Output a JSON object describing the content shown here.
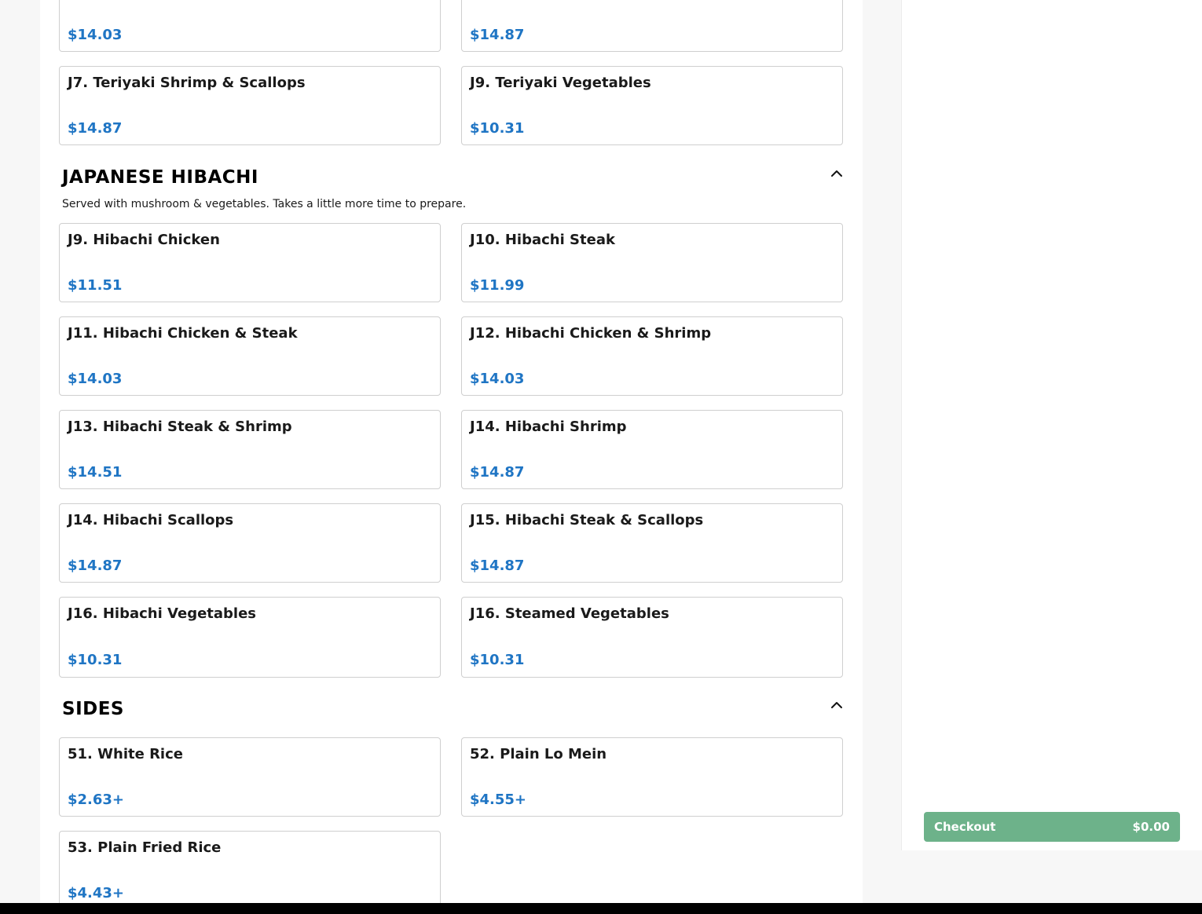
{
  "teriyaki": {
    "items": [
      {
        "name": "",
        "price": "$14.03"
      },
      {
        "name": "",
        "price": "$14.87"
      },
      {
        "name": "J7. Teriyaki Shrimp & Scallops",
        "price": "$14.87"
      },
      {
        "name": "J9. Teriyaki Vegetables",
        "price": "$10.31"
      }
    ]
  },
  "hibachi": {
    "title": "JAPANESE HIBACHI",
    "description": "Served with mushroom & vegetables. Takes a little more time to prepare.",
    "collapse_icon": "chevron-up-icon",
    "items": [
      {
        "name": "J9. Hibachi Chicken",
        "price": "$11.51"
      },
      {
        "name": "J10. Hibachi Steak",
        "price": "$11.99"
      },
      {
        "name": "J11. Hibachi Chicken & Steak",
        "price": "$14.03"
      },
      {
        "name": "J12. Hibachi Chicken & Shrimp",
        "price": "$14.03"
      },
      {
        "name": "J13. Hibachi Steak & Shrimp",
        "price": "$14.51"
      },
      {
        "name": "J14. Hibachi Shrimp",
        "price": "$14.87"
      },
      {
        "name": "J14. Hibachi Scallops",
        "price": "$14.87"
      },
      {
        "name": "J15. Hibachi Steak & Scallops",
        "price": "$14.87"
      },
      {
        "name": "J16. Hibachi Vegetables",
        "price": "$10.31"
      },
      {
        "name": "J16. Steamed Vegetables",
        "price": "$10.31"
      }
    ]
  },
  "sides": {
    "title": "SIDES",
    "collapse_icon": "chevron-up-icon",
    "items": [
      {
        "name": "51. White Rice",
        "price": "$2.63+"
      },
      {
        "name": "52. Plain Lo Mein",
        "price": "$4.55+"
      },
      {
        "name": "53. Plain Fried Rice",
        "price": "$4.43+"
      }
    ]
  },
  "cart": {
    "checkout_label": "Checkout",
    "total": "$0.00"
  },
  "colors": {
    "price": "#1f75c4",
    "checkout_button": "#6db28a"
  }
}
